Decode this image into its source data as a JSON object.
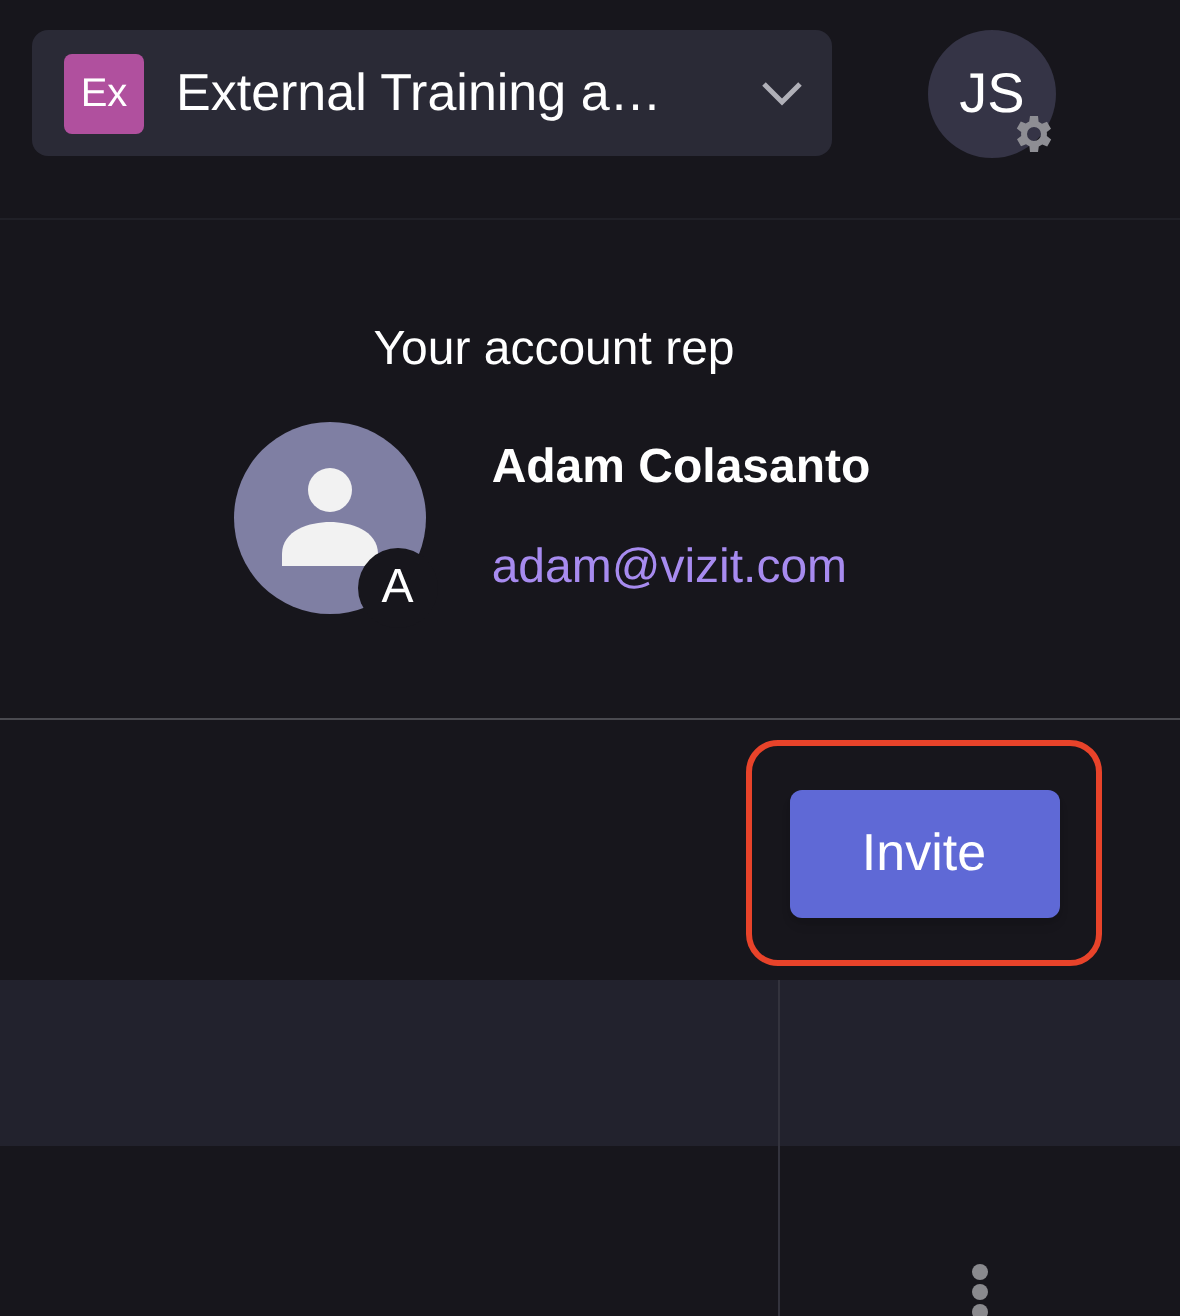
{
  "workspace_selector": {
    "badge": "Ex",
    "name": "External Training a…"
  },
  "user_menu": {
    "initials": "JS"
  },
  "account_rep": {
    "heading": "Your account rep",
    "avatar_initial": "A",
    "name": "Adam Colasanto",
    "email": "adam@vizit.com"
  },
  "invite_button": {
    "label": "Invite",
    "highlighted": true
  }
}
